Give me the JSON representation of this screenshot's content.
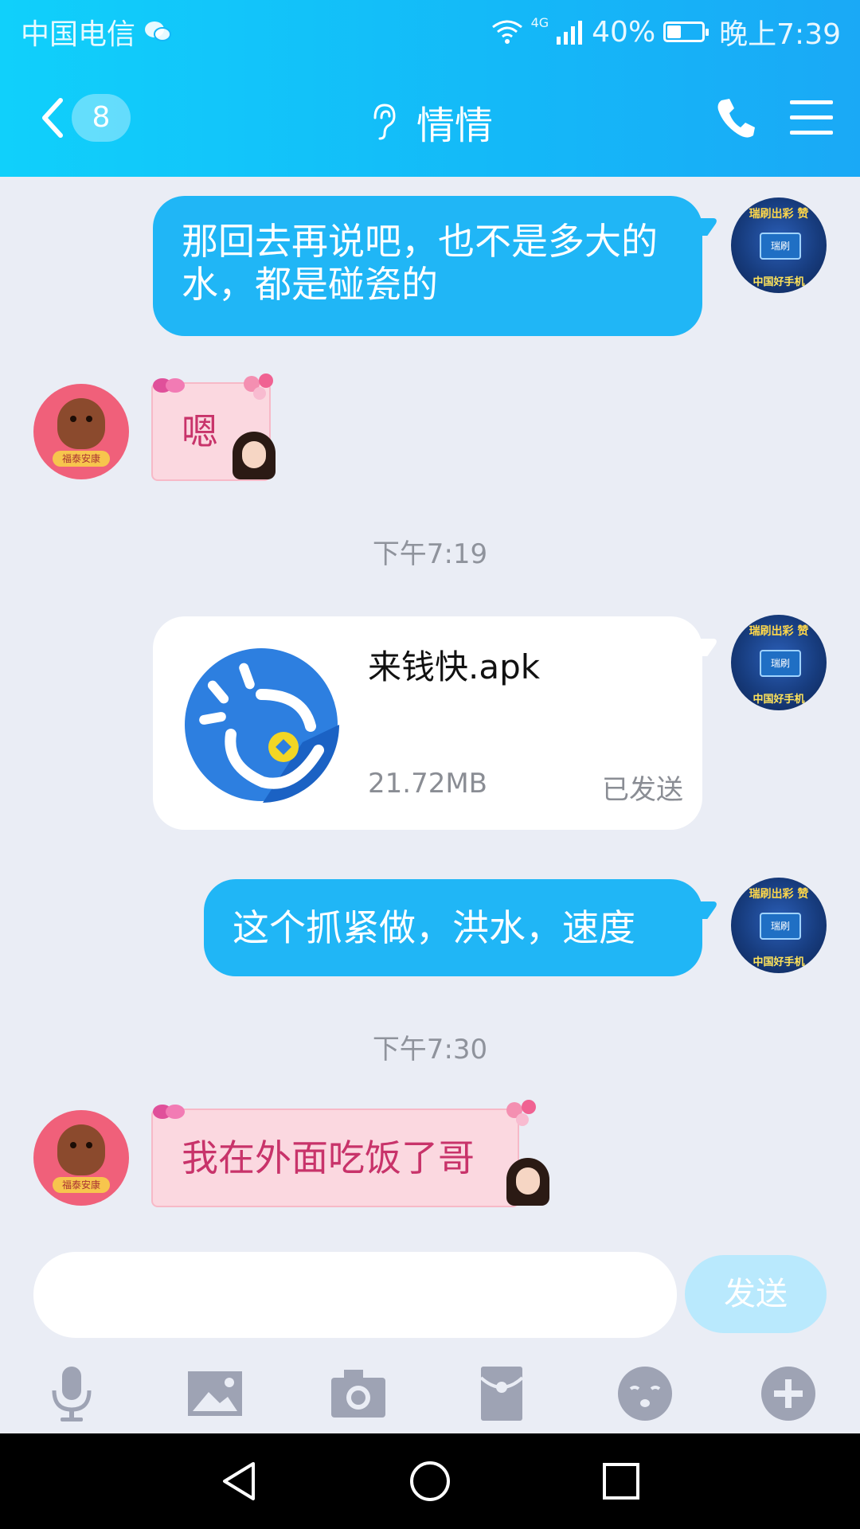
{
  "status_bar": {
    "carrier": "中国电信",
    "network": "4G",
    "battery": "40%",
    "battery_level": 0.4,
    "time": "晚上7:39"
  },
  "nav": {
    "unread_count": "8",
    "contact_name": "情情"
  },
  "messages": [
    {
      "side": "right",
      "type": "text",
      "text": "那回去再说吧，也不是多大的水，都是碰瓷的"
    },
    {
      "side": "left",
      "type": "text",
      "text": "嗯"
    },
    {
      "type": "timestamp",
      "text": "下午7:19"
    },
    {
      "side": "right",
      "type": "file",
      "file_name": "来钱快.apk",
      "file_size": "21.72MB",
      "status": "已发送"
    },
    {
      "side": "right",
      "type": "text",
      "text": "这个抓紧做，洪水，速度"
    },
    {
      "type": "timestamp",
      "text": "下午7:30"
    },
    {
      "side": "left",
      "type": "text",
      "text": "我在外面吃饭了哥"
    }
  ],
  "avatars": {
    "me": {
      "top": "瑞刷出彩 赞",
      "mid": "瑞刷",
      "bottom": "中国好手机"
    },
    "her": {
      "tag": "福泰安康"
    }
  },
  "input": {
    "placeholder": "",
    "send_label": "发送"
  },
  "toolbar": [
    "mic-icon",
    "image-icon",
    "camera-icon",
    "red-packet-icon",
    "emoji-icon",
    "plus-icon"
  ],
  "colors": {
    "header": "#14b8f8",
    "bubble_blue": "#20b6f6",
    "bubble_pink": "#fbd8e0",
    "pink_text": "#c8336a",
    "background": "#eaedf5"
  }
}
